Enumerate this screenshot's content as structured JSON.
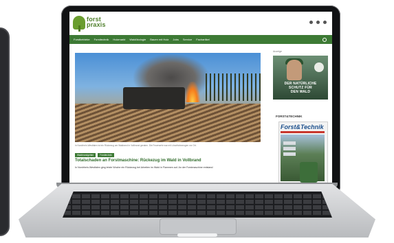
{
  "site": {
    "logo_text": "forst praxis",
    "social_icons": [
      "mail-icon",
      "twitter-icon",
      "facebook-icon"
    ]
  },
  "nav": {
    "items": [
      "Forstbetriebe",
      "Forsttechnik",
      "Holzmarkt",
      "Waldökologie",
      "Bauen mit Holz",
      "Jobs",
      "Service",
      "Fachartikel"
    ],
    "search_icon": "search-icon"
  },
  "article": {
    "image_caption": "In Nordrhein-Westfalen ist ein Rückezug am Waldrand in Vollbrand geraten. Die Feuerwehr war mit Löschfahrzeugen vor Ort.",
    "tags": [
      "Waldbrandgefahr",
      "Forsttechnik"
    ],
    "headline": "Totalschaden an Forstmaschine: Rückezug im Wald in Vollbrand",
    "teaser": "In Nordrhein-Westfalen ging letzte Woche ein Rückezug bei Arbeiten im Wald in Flammen auf. An der Forstmaschine entstand"
  },
  "sidebar": {
    "label": "Anzeige",
    "ad_text_lines": [
      "DER NATÜRLICHE",
      "SCHUTZ FÜR",
      "DEN WALD"
    ],
    "magazine_heading": "FORST&TECHNIK",
    "magazine_title": "Forst&Technik"
  },
  "colors": {
    "nav_green": "#3d7a35",
    "logo_green": "#6a9d2f",
    "headline_green": "#2f6b2a",
    "magazine_blue": "#1b4f8c"
  }
}
